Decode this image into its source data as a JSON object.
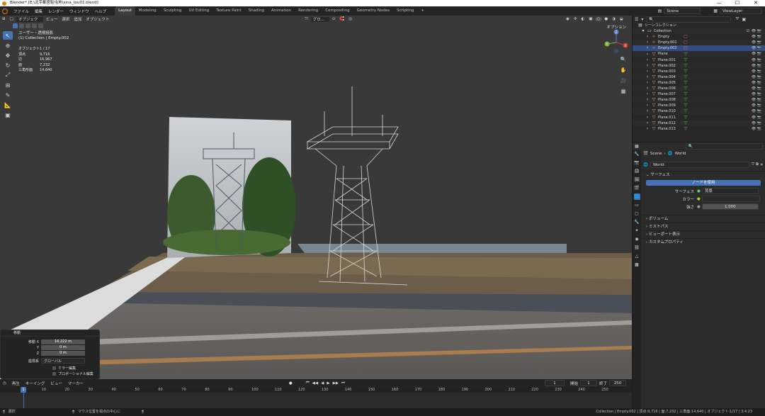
{
  "window": {
    "title": "Blender* [E:\\北宇都宮駐屯地\\sina_tou01.blend]",
    "minimize": "—",
    "maximize": "☐",
    "close": "✕"
  },
  "menu": [
    "ファイル",
    "編集",
    "レンダー",
    "ウィンドウ",
    "ヘルプ"
  ],
  "workspaces": [
    "Layout",
    "Modeling",
    "Sculpting",
    "UV Editing",
    "Texture Paint",
    "Shading",
    "Animation",
    "Rendering",
    "Compositing",
    "Geometry Nodes",
    "Scripting"
  ],
  "workspace_add": "+",
  "scene": {
    "name": "Scene",
    "viewlayer": "ViewLayer"
  },
  "viewport": {
    "header": {
      "mode": "オブジェクト",
      "menus": [
        "ビュー",
        "選択",
        "追加",
        "オブジェクト"
      ],
      "transform": "グロ...",
      "options": "オプション"
    },
    "view_name": "ユーザー・透視投影",
    "collection_line": "(1) Collection | Empty.002",
    "stats": [
      {
        "k": "オブジェクト",
        "v": "1 / 17"
      },
      {
        "k": "頂点",
        "v": "9,716"
      },
      {
        "k": "辺",
        "v": "16,967"
      },
      {
        "k": "面",
        "v": "7,232"
      },
      {
        "k": "三角形面",
        "v": "14,640"
      }
    ],
    "gizmo": {
      "z": "Z",
      "y": "Y",
      "x": "X"
    }
  },
  "operator": {
    "title": "移動",
    "rows": [
      {
        "label": "移動 X",
        "value": "16.222 m"
      },
      {
        "label": "Y",
        "value": "0 m"
      },
      {
        "label": "Z",
        "value": "0 m"
      }
    ],
    "orient_label": "座標系",
    "orient_value": "グローバル",
    "checks": [
      "ミラー編集",
      "プロポーショナル編集"
    ]
  },
  "timeline": {
    "menus": [
      "再生",
      "キーイング",
      "ビュー",
      "マーカー"
    ],
    "current": "1",
    "start_label": "開始",
    "start": "1",
    "end_label": "終了",
    "end": "250",
    "ticks": [
      "10",
      "20",
      "30",
      "40",
      "50",
      "60",
      "70",
      "80",
      "90",
      "100",
      "110",
      "120",
      "130",
      "140",
      "150",
      "160",
      "170",
      "180",
      "190",
      "200",
      "210",
      "220",
      "230",
      "240",
      "250"
    ],
    "frame_marker": "1"
  },
  "status": {
    "left": "選択",
    "middle": "マウス位置を視点の中心に",
    "right": "Collection | Empty.002 | 頂点:9,716 | 面:7,232 | 三角面:14,640 | オブジェクト:1/17 | 3.4.23"
  },
  "outliner": {
    "scene_collection": "シーンコレクション",
    "collection": "Collection",
    "items": [
      {
        "name": "Empty",
        "type": "empty"
      },
      {
        "name": "Empty.001",
        "type": "empty"
      },
      {
        "name": "Empty.002",
        "type": "empty",
        "selected": true
      },
      {
        "name": "Plane",
        "type": "mesh"
      },
      {
        "name": "Plane.001",
        "type": "mesh"
      },
      {
        "name": "Plane.002",
        "type": "mesh"
      },
      {
        "name": "Plane.003",
        "type": "mesh"
      },
      {
        "name": "Plane.004",
        "type": "mesh"
      },
      {
        "name": "Plane.005",
        "type": "mesh"
      },
      {
        "name": "Plane.006",
        "type": "mesh"
      },
      {
        "name": "Plane.007",
        "type": "mesh"
      },
      {
        "name": "Plane.008",
        "type": "mesh"
      },
      {
        "name": "Plane.009",
        "type": "mesh"
      },
      {
        "name": "Plane.010",
        "type": "mesh"
      },
      {
        "name": "Plane.011",
        "type": "mesh"
      },
      {
        "name": "Plane.012",
        "type": "mesh"
      },
      {
        "name": "Plane.013",
        "type": "mesh"
      }
    ]
  },
  "properties": {
    "breadcrumb_scene": "Scene",
    "breadcrumb_world": "World",
    "world_name": "World",
    "surface_section": "サーフェス",
    "use_nodes": "ノードを使用",
    "surface_label": "サーフェス",
    "surface_value": "背景",
    "color_label": "カラー",
    "strength_label": "強さ",
    "strength_value": "1.000",
    "sections": [
      "ボリューム",
      "ミストパス",
      "ビューポート表示",
      "カスタムプロパティ"
    ]
  },
  "colors": {
    "accent": "#4772b3",
    "selected_row": "#334d80",
    "orange": "#e87d0d"
  }
}
